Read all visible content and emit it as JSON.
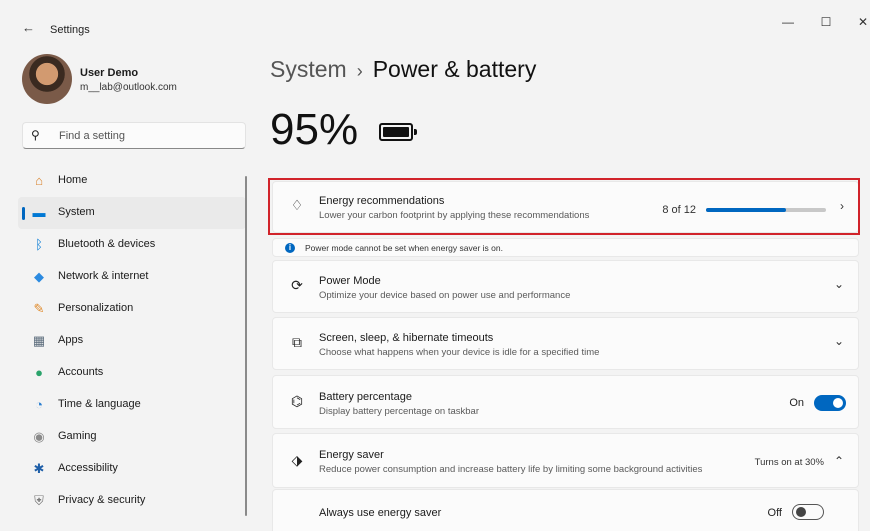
{
  "window": {
    "title": "Settings",
    "back_icon": "←",
    "minimize_icon": "—",
    "maximize_icon": "☐",
    "close_icon": "✕"
  },
  "user": {
    "name": "User Demo",
    "email": "m__lab@outlook.com"
  },
  "search": {
    "placeholder": "Find a setting",
    "icon": "⚲"
  },
  "sidebar": {
    "items": [
      {
        "label": "Home",
        "icon": "⌂",
        "color": "#d9822b"
      },
      {
        "label": "System",
        "icon": "▬",
        "color": "#0078d4"
      },
      {
        "label": "Bluetooth & devices",
        "icon": "ᛒ",
        "color": "#0078d4"
      },
      {
        "label": "Network & internet",
        "icon": "◆",
        "color": "#2b8ae0"
      },
      {
        "label": "Personalization",
        "icon": "✎",
        "color": "#e08a2b"
      },
      {
        "label": "Apps",
        "icon": "▦",
        "color": "#5a6b7b"
      },
      {
        "label": "Accounts",
        "icon": "●",
        "color": "#2aa36b"
      },
      {
        "label": "Time & language",
        "icon": "◔",
        "color": "#2b7fd0"
      },
      {
        "label": "Gaming",
        "icon": "◉",
        "color": "#8a8a8a"
      },
      {
        "label": "Accessibility",
        "icon": "✱",
        "color": "#1f5fa8"
      },
      {
        "label": "Privacy & security",
        "icon": "⛨",
        "color": "#7a7a7a"
      }
    ]
  },
  "header": {
    "parent": "System",
    "separator": "›",
    "current": "Power & battery"
  },
  "battery": {
    "percent_label": "95%"
  },
  "energy_recommendations": {
    "title": "Energy recommendations",
    "description": "Lower your carbon footprint by applying these recommendations",
    "count_label": "8 of 12",
    "progress_fraction": 0.6667,
    "accent": "#0067c0"
  },
  "notice": {
    "icon": "i",
    "text": "Power mode cannot be set when energy saver is on."
  },
  "cards": {
    "power_mode": {
      "title": "Power Mode",
      "description": "Optimize your device based on power use and performance",
      "icon": "⟳"
    },
    "screen_sleep": {
      "title": "Screen, sleep, & hibernate timeouts",
      "description": "Choose what happens when your device is idle for a specified time",
      "icon": "⧉"
    },
    "battery_percentage": {
      "title": "Battery percentage",
      "description": "Display battery percentage on taskbar",
      "state_label": "On",
      "icon": "⌬"
    },
    "energy_saver": {
      "title": "Energy saver",
      "description": "Reduce power consumption and increase battery life by limiting some background activities",
      "status": "Turns on at 30%",
      "icon": "⬗"
    },
    "always_energy_saver": {
      "title": "Always use energy saver",
      "state_label": "Off"
    }
  },
  "icons": {
    "chevron_right": "›",
    "chevron_down": "⌄",
    "chevron_up": "⌃",
    "leaf": "♢"
  }
}
